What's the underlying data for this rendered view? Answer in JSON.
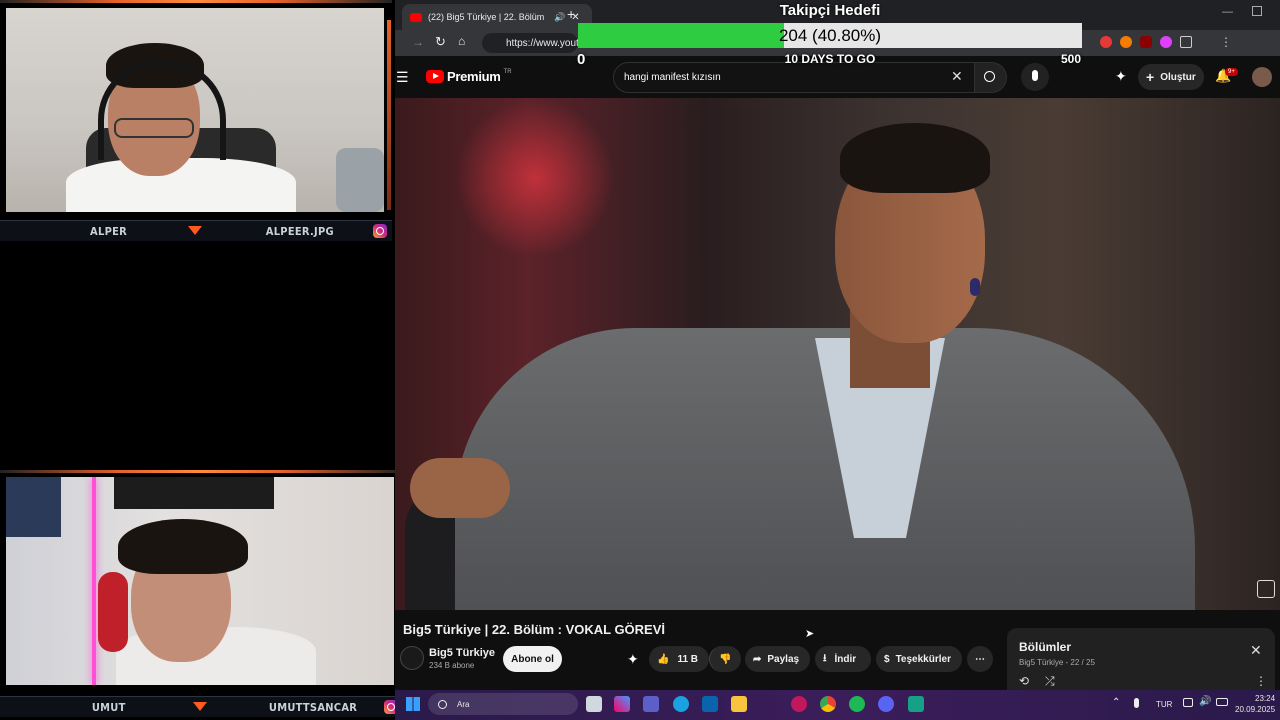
{
  "overlay": {
    "goal_title": "Takipçi Hedefi",
    "goal_current_text": "204 (40.80%)",
    "goal_progress_percent": 40.8,
    "goal_min": "0",
    "goal_max": "500",
    "goal_subtitle": "10 DAYS TO GO"
  },
  "webcams": [
    {
      "name": "ALPER",
      "handle": "ALPEER.JPG"
    },
    {
      "name": "UMUT",
      "handle": "UMUTTSANCAR"
    }
  ],
  "browser": {
    "tab_title": "(22) Big5 Türkiye | 22. Bölüm",
    "url": "https://www.yout"
  },
  "youtube": {
    "logo": "Premium",
    "logo_region": "TR",
    "search_value": "hangi manifest kızısın",
    "create_label": "Oluştur",
    "notifications_badge": "9+",
    "video_title": "Big5 Türkiye | 22. Bölüm : VOKAL GÖREVİ",
    "channel_name": "Big5 Türkiye",
    "subscribers": "234 B abone",
    "subscribe_label": "Abone ol",
    "likes": "11 B",
    "share_label": "Paylaş",
    "download_label": "İndir",
    "thanks_label": "Teşekkürler",
    "episodes_title": "Bölümler",
    "episodes_sub": "Big5 Türkiye - 22 / 25"
  },
  "taskbar": {
    "search_placeholder": "Ara",
    "language": "TUR",
    "time": "23:24",
    "date": "20.09.2025"
  },
  "colors": {
    "accent_orange": "#ff5a1f",
    "goal_green": "#2ecc40",
    "youtube_red": "#ff0000"
  }
}
